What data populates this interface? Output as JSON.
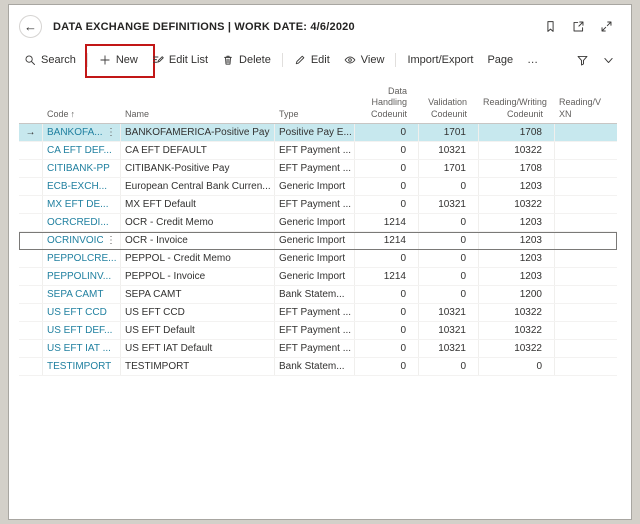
{
  "header": {
    "title": "DATA EXCHANGE DEFINITIONS | WORK DATE: 4/6/2020",
    "back_glyph": "←"
  },
  "header_icons": [
    "bookmark-icon",
    "popout-icon",
    "expand-icon"
  ],
  "toolbar": {
    "items": [
      {
        "name": "search-button",
        "label": "Search",
        "icon": "search-icon",
        "divider_after": true
      },
      {
        "name": "new-button",
        "label": "New",
        "icon": "plus-icon",
        "highlighted": true
      },
      {
        "name": "edit-list-button",
        "label": "Edit List",
        "icon": "edit-list-icon"
      },
      {
        "name": "delete-button",
        "label": "Delete",
        "icon": "delete-icon",
        "divider_after": true
      },
      {
        "name": "edit-button",
        "label": "Edit",
        "icon": "edit-icon"
      },
      {
        "name": "view-button",
        "label": "View",
        "icon": "view-icon",
        "divider_after": true
      },
      {
        "name": "import-export-button",
        "label": "Import/Export"
      },
      {
        "name": "page-button",
        "label": "Page"
      },
      {
        "name": "more-options-button",
        "label": "…"
      }
    ],
    "right_icons": [
      "filter-icon",
      "chevron-down-icon"
    ]
  },
  "table": {
    "row_indicator": "→",
    "menu_glyph": "⋮",
    "columns": [
      {
        "key": "code",
        "label": "Code",
        "sort": "↑"
      },
      {
        "key": "name",
        "label": "Name"
      },
      {
        "key": "type",
        "label": "Type"
      },
      {
        "key": "data_handling",
        "label": "Data Handling Codeunit",
        "align": "right"
      },
      {
        "key": "validation",
        "label": "Validation Codeunit",
        "align": "right"
      },
      {
        "key": "reading_writing",
        "label": "Reading/Writing Codeunit",
        "align": "right"
      },
      {
        "key": "xmlport",
        "label": "Reading/V\nXN"
      }
    ],
    "rows": [
      {
        "code": "BANKOFA...",
        "name": "BANKOFAMERICA-Positive Pay",
        "type": "Positive Pay E...",
        "data_handling": "0",
        "validation": "1701",
        "reading_writing": "1708",
        "xmlport": "",
        "selected": true,
        "menu": true
      },
      {
        "code": "CA EFT DEF...",
        "name": "CA EFT DEFAULT",
        "type": "EFT Payment ...",
        "data_handling": "0",
        "validation": "10321",
        "reading_writing": "10322",
        "xmlport": ""
      },
      {
        "code": "CITIBANK-PP",
        "name": "CITIBANK-Positive Pay",
        "type": "EFT Payment ...",
        "data_handling": "0",
        "validation": "1701",
        "reading_writing": "1708",
        "xmlport": ""
      },
      {
        "code": "ECB-EXCH...",
        "name": "European Central Bank Curren...",
        "type": "Generic Import",
        "data_handling": "0",
        "validation": "0",
        "reading_writing": "1203",
        "xmlport": ""
      },
      {
        "code": "MX EFT DE...",
        "name": "MX EFT Default",
        "type": "EFT Payment ...",
        "data_handling": "0",
        "validation": "10321",
        "reading_writing": "10322",
        "xmlport": ""
      },
      {
        "code": "OCRCREDI...",
        "name": "OCR - Credit Memo",
        "type": "Generic Import",
        "data_handling": "1214",
        "validation": "0",
        "reading_writing": "1203",
        "xmlport": ""
      },
      {
        "code": "OCRINVOICE",
        "name": "OCR - Invoice",
        "type": "Generic Import",
        "data_handling": "1214",
        "validation": "0",
        "reading_writing": "1203",
        "xmlport": "",
        "focused": true,
        "menu": true
      },
      {
        "code": "PEPPOLCRE...",
        "name": "PEPPOL - Credit Memo",
        "type": "Generic Import",
        "data_handling": "0",
        "validation": "0",
        "reading_writing": "1203",
        "xmlport": ""
      },
      {
        "code": "PEPPOLINV...",
        "name": "PEPPOL - Invoice",
        "type": "Generic Import",
        "data_handling": "1214",
        "validation": "0",
        "reading_writing": "1203",
        "xmlport": ""
      },
      {
        "code": "SEPA CAMT",
        "name": "SEPA CAMT",
        "type": "Bank Statem...",
        "data_handling": "0",
        "validation": "0",
        "reading_writing": "1200",
        "xmlport": ""
      },
      {
        "code": "US EFT CCD",
        "name": "US EFT CCD",
        "type": "EFT Payment ...",
        "data_handling": "0",
        "validation": "10321",
        "reading_writing": "10322",
        "xmlport": ""
      },
      {
        "code": "US EFT DEF...",
        "name": "US EFT Default",
        "type": "EFT Payment ...",
        "data_handling": "0",
        "validation": "10321",
        "reading_writing": "10322",
        "xmlport": ""
      },
      {
        "code": "US EFT IAT ...",
        "name": "US EFT IAT Default",
        "type": "EFT Payment ...",
        "data_handling": "0",
        "validation": "10321",
        "reading_writing": "10322",
        "xmlport": ""
      },
      {
        "code": "TESTIMPORT",
        "name": "TESTIMPORT",
        "type": "Bank Statem...",
        "data_handling": "0",
        "validation": "0",
        "reading_writing": "0",
        "xmlport": ""
      }
    ]
  },
  "colors": {
    "selected_row": "#c7e8ee",
    "link": "#2080a0",
    "annotation": "#c21717",
    "page_background": "#d3d0c9"
  }
}
